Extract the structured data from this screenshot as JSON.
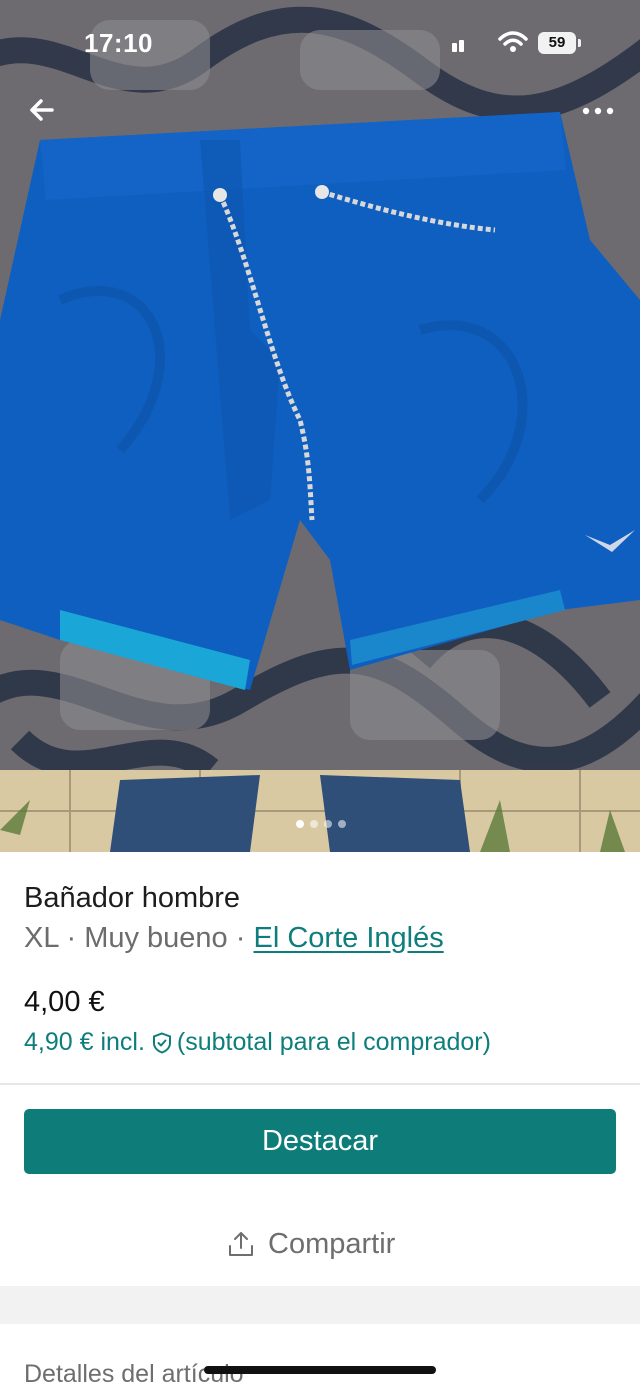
{
  "status_bar": {
    "time": "17:10",
    "battery": "59"
  },
  "photo": {
    "subject": "blue swim shorts on patterned sofa",
    "image_count": 4,
    "active_index": 0
  },
  "icons": {
    "back": "back-arrow-icon",
    "more": "more-horizontal-icon",
    "verified": "shield-check-icon",
    "share": "share-upload-icon"
  },
  "item": {
    "title": "Bañador hombre",
    "size": "XL",
    "sep1": "·",
    "condition": "Muy bueno",
    "sep2": "·",
    "brand": "El Corte Inglés",
    "price": "4,00 €",
    "buyer_price": "4,90 € incl.",
    "buyer_note": "(subtotal para el comprador)"
  },
  "actions": {
    "promote_label": "Destacar",
    "share_label": "Compartir"
  },
  "sections": {
    "details_heading": "Detalles del artículo"
  },
  "colors": {
    "accent": "#0e7c78",
    "link": "#0d7e7c",
    "shorts": "#0f5fc0"
  }
}
